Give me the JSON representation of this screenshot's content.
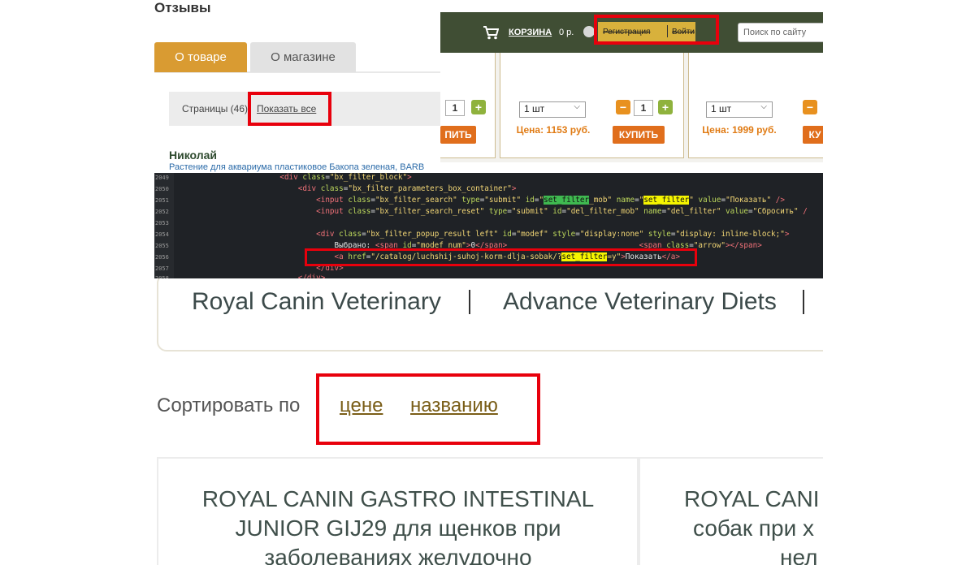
{
  "reviews_panel": {
    "heading": "Отзывы",
    "tabs": [
      {
        "label": "О товаре",
        "active": true
      },
      {
        "label": "О магазине",
        "active": false
      }
    ],
    "pages_label": "Страницы (46)",
    "show_all_link": "Показать все",
    "author": "Николай",
    "review_text": "Растение для аквариума пластиковое Бакопа зеленая, BARB"
  },
  "shop_panel": {
    "cart_label": "КОРЗИНА",
    "cart_amount": "0 р.",
    "register_link": "Регистрация",
    "login_link": "Войти",
    "search_placeholder": "Поиск по сайту",
    "cards": [
      {
        "qty": "1",
        "buy_label": "ПИТЬ"
      },
      {
        "unit": "1 шт",
        "price": "Цена: 1153 руб.",
        "qty": "1",
        "buy_label": "КУПИТЬ"
      },
      {
        "unit": "1 шт",
        "price": "Цена: 1999 руб.",
        "buy_label": "КУ"
      }
    ],
    "colors": {
      "header_bg": "#404e34",
      "auth_bg": "#d8b13c",
      "price": "#e07b14",
      "buy": "#e06e1c"
    }
  },
  "code_panel": {
    "lines": [
      {
        "num": "2049"
      },
      {
        "num": "2050"
      },
      {
        "num": "2051"
      },
      {
        "num": "2052"
      },
      {
        "num": "2053"
      },
      {
        "num": "2054"
      },
      {
        "num": "2055"
      },
      {
        "num": "2056"
      },
      {
        "num": "2057"
      },
      {
        "num": "2058"
      }
    ]
  },
  "brands_panel": {
    "brands": [
      "Royal Canin Veterinary",
      "Advance Veterinary Diets"
    ]
  },
  "sort_panel": {
    "label": "Сортировать по",
    "options": [
      "цене",
      "названию"
    ]
  },
  "products_panel": {
    "product_1_lines": [
      "ROYAL CANIN GASTRO INTESTINAL",
      "JUNIOR GIJ29 для щенков при",
      "заболеваниях желудочно"
    ],
    "product_2_lines": [
      "ROYAL CANI",
      "собак при х",
      "нел"
    ]
  },
  "highlight_color": "#e8000c"
}
